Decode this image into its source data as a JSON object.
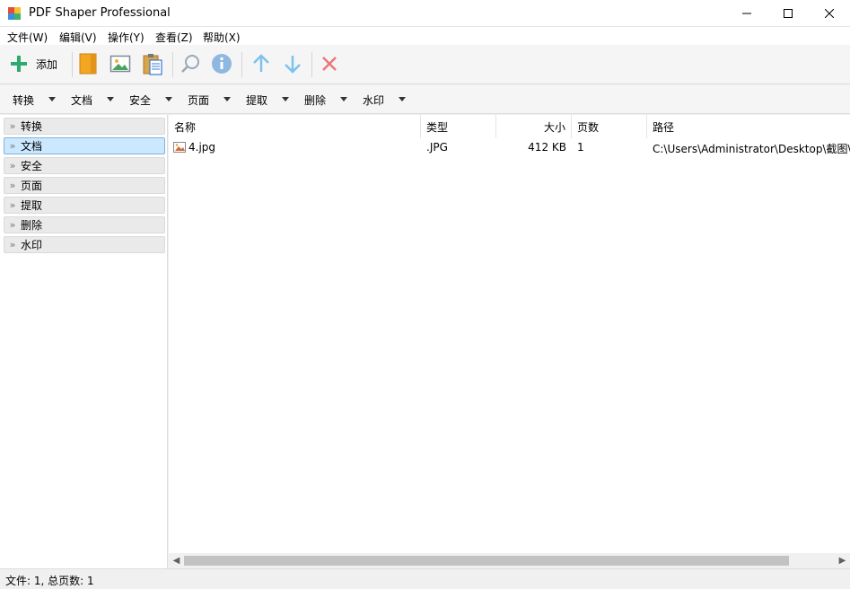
{
  "window": {
    "title": "PDF Shaper Professional"
  },
  "menu": [
    "文件(W)",
    "编辑(V)",
    "操作(Y)",
    "查看(Z)",
    "帮助(X)"
  ],
  "toolbar": {
    "add_label": "添加"
  },
  "categories": [
    "转换",
    "文档",
    "安全",
    "页面",
    "提取",
    "删除",
    "水印"
  ],
  "sidebar": {
    "items": [
      "转换",
      "文档",
      "安全",
      "页面",
      "提取",
      "删除",
      "水印"
    ],
    "selected": "文档"
  },
  "table": {
    "columns": [
      "名称",
      "类型",
      "大小",
      "页数",
      "路径"
    ],
    "rows": [
      {
        "name": "4.jpg",
        "type": ".JPG",
        "size": "412 KB",
        "pages": "1",
        "path": "C:\\Users\\Administrator\\Desktop\\截图\\"
      }
    ]
  },
  "status": {
    "text": "文件: 1, 总页数: 1"
  },
  "colors": {
    "accent": "#0078d7",
    "selection": "#cce8ff",
    "add_green": "#2eaa6e",
    "arrow_blue": "#5ab2e8",
    "delete_red": "#e05050"
  }
}
